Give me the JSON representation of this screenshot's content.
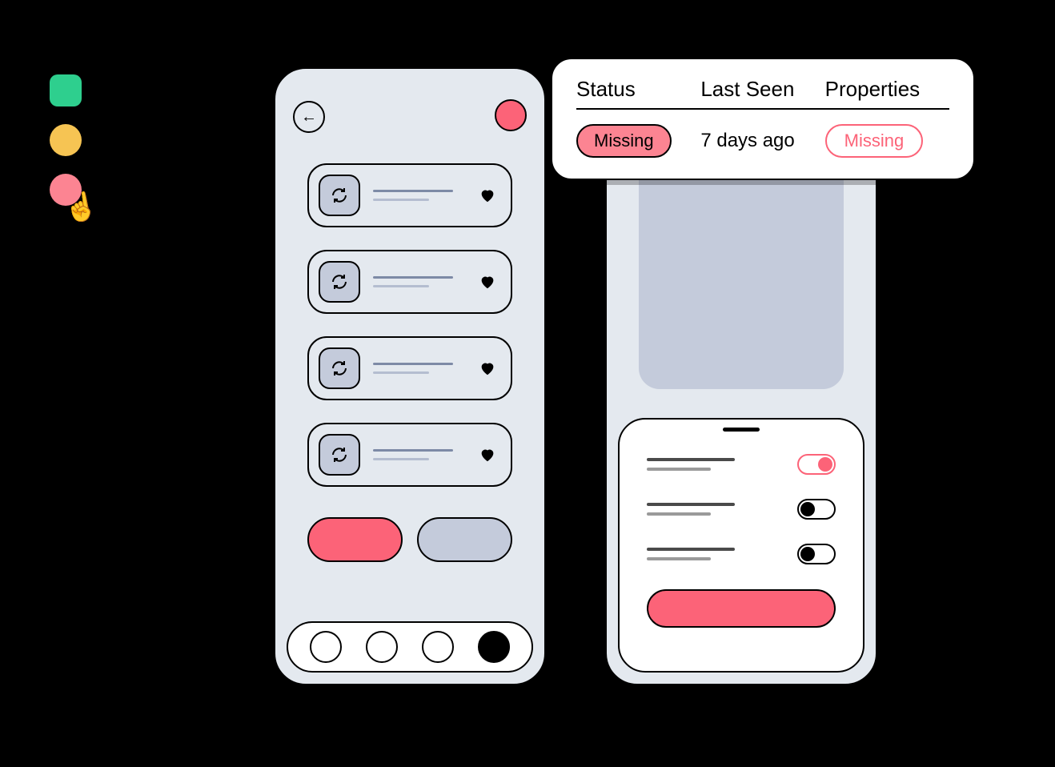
{
  "colors": {
    "green": "#2ecf8e",
    "amber": "#f6c453",
    "pink": "#fc8492",
    "accent": "#fc6378",
    "surface": "#e4e9ef",
    "muted": "#c4cbdb"
  },
  "legend": {
    "items": [
      "status-ok",
      "status-warning",
      "status-missing"
    ],
    "selected_index": 2
  },
  "phone_a": {
    "back_icon": "arrow-left",
    "status_color": "pink",
    "list_items": [
      {
        "icon": "sync",
        "favorite": true
      },
      {
        "icon": "sync",
        "favorite": true
      },
      {
        "icon": "sync",
        "favorite": true
      },
      {
        "icon": "sync",
        "favorite": true
      }
    ],
    "primary_button": "",
    "secondary_button": "",
    "nav_count": 4,
    "nav_active_index": 3
  },
  "phone_b": {
    "toggles": [
      {
        "on": true
      },
      {
        "on": false
      },
      {
        "on": false
      }
    ],
    "cta_label": ""
  },
  "popover": {
    "columns": {
      "status": "Status",
      "last_seen": "Last Seen",
      "properties": "Properties"
    },
    "row": {
      "status_badge": "Missing",
      "last_seen_value": "7 days ago",
      "properties_badge": "Missing"
    }
  }
}
